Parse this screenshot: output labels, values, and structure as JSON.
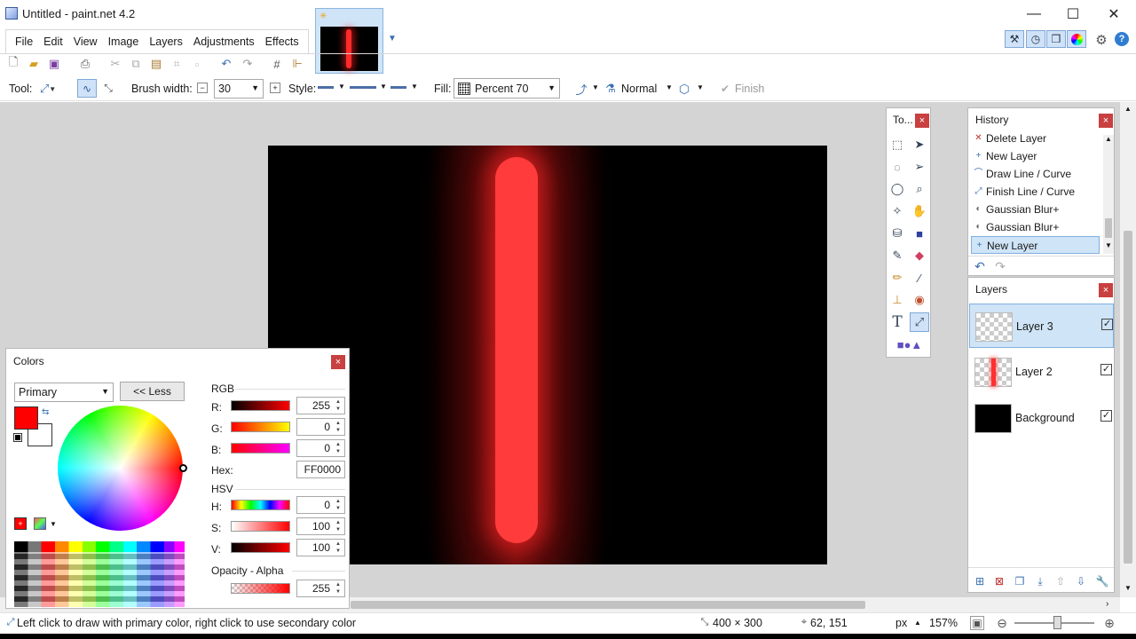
{
  "window": {
    "title": "Untitled - paint.net 4.2"
  },
  "menu": [
    "File",
    "Edit",
    "View",
    "Image",
    "Layers",
    "Adjustments",
    "Effects"
  ],
  "toolbar": {
    "tool_label": "Tool:",
    "brush_width_label": "Brush width:",
    "brush_width_value": "30",
    "style_label": "Style:",
    "fill_label": "Fill:",
    "fill_value": "Percent 70",
    "blend_mode": "Normal",
    "finish_label": "Finish"
  },
  "tools_window": {
    "title": "To..."
  },
  "history": {
    "title": "History",
    "items": [
      {
        "label": "Delete Layer",
        "icon": "delete-layer-icon"
      },
      {
        "label": "New Layer",
        "icon": "new-layer-icon"
      },
      {
        "label": "Draw Line / Curve",
        "icon": "line-curve-icon"
      },
      {
        "label": "Finish Line / Curve",
        "icon": "line-curve-icon"
      },
      {
        "label": "Gaussian Blur+",
        "icon": "gaussian-blur-icon"
      },
      {
        "label": "Gaussian Blur+",
        "icon": "gaussian-blur-icon"
      },
      {
        "label": "New Layer",
        "icon": "new-layer-icon",
        "selected": true
      }
    ]
  },
  "layers": {
    "title": "Layers",
    "items": [
      {
        "name": "Layer 3",
        "visible": true,
        "selected": true
      },
      {
        "name": "Layer 2",
        "visible": true
      },
      {
        "name": "Background",
        "visible": true
      }
    ]
  },
  "colors": {
    "title": "Colors",
    "mode": "Primary",
    "less_button": "<< Less",
    "rgb_label": "RGB",
    "r_label": "R:",
    "r": "255",
    "g_label": "G:",
    "g": "0",
    "b_label": "B:",
    "b": "0",
    "hex_label": "Hex:",
    "hex": "FF0000",
    "hsv_label": "HSV",
    "h_label": "H:",
    "h": "0",
    "s_label": "S:",
    "s": "100",
    "v_label": "V:",
    "v": "100",
    "opacity_label": "Opacity - Alpha",
    "alpha": "255",
    "primary_color": "#ff0000",
    "secondary_color": "#ffffff"
  },
  "status": {
    "hint": "Left click to draw with primary color, right click to use secondary color",
    "image_size": "400 × 300",
    "cursor_pos": "62, 151",
    "units": "px",
    "zoom": "157%"
  }
}
